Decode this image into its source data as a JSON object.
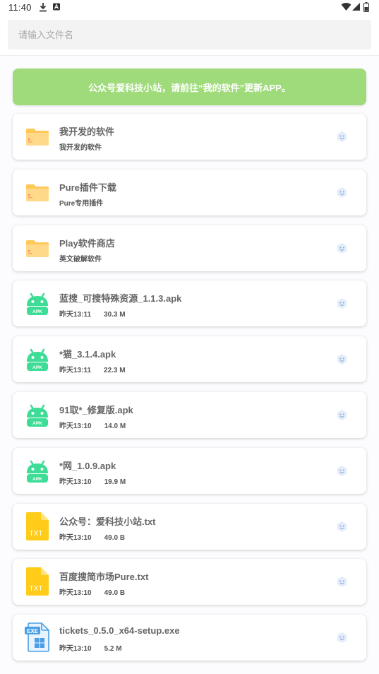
{
  "status_bar": {
    "time": "11:40"
  },
  "search": {
    "placeholder": "请输入文件名"
  },
  "banner": {
    "text": "公众号爱科技小站，请前往“我的软件”更新APP。"
  },
  "files": [
    {
      "type": "folder",
      "name": "我开发的软件",
      "subtitle": "我开发的软件",
      "size": ""
    },
    {
      "type": "folder",
      "name": "Pure插件下载",
      "subtitle": "Pure专用插件",
      "size": ""
    },
    {
      "type": "folder",
      "name": "Play软件商店",
      "subtitle": "英文破解软件",
      "size": ""
    },
    {
      "type": "apk",
      "icon_label": "APK",
      "name": "蓝搜_可搜特殊资源_1.1.3.apk",
      "subtitle": "昨天13:11",
      "size": "30.3 M"
    },
    {
      "type": "apk",
      "icon_label": "APK",
      "name": "*猫_3.1.4.apk",
      "subtitle": "昨天13:11",
      "size": "22.3 M"
    },
    {
      "type": "apk",
      "icon_label": "APK",
      "name": "91取*_修复版.apk",
      "subtitle": "昨天13:10",
      "size": "14.0 M"
    },
    {
      "type": "apk",
      "icon_label": "APK",
      "name": "*网_1.0.9.apk",
      "subtitle": "昨天13:10",
      "size": "19.9 M"
    },
    {
      "type": "txt",
      "icon_label": "TXT",
      "name": "公众号：爱科技小站.txt",
      "subtitle": "昨天13:10",
      "size": "49.0 B"
    },
    {
      "type": "txt",
      "icon_label": "TXT",
      "name": "百度搜简市场Pure.txt",
      "subtitle": "昨天13:10",
      "size": "49.0 B"
    },
    {
      "type": "exe",
      "icon_label": "EXE",
      "name": "tickets_0.5.0_x64-setup.exe",
      "subtitle": "昨天13:10",
      "size": "5.2 M"
    }
  ],
  "colors": {
    "banner": "#9fdb7a",
    "folder": "#ffd57a",
    "apk": "#3ddc97",
    "txt": "#ffcc1a",
    "exe": "#4a9fe6"
  }
}
